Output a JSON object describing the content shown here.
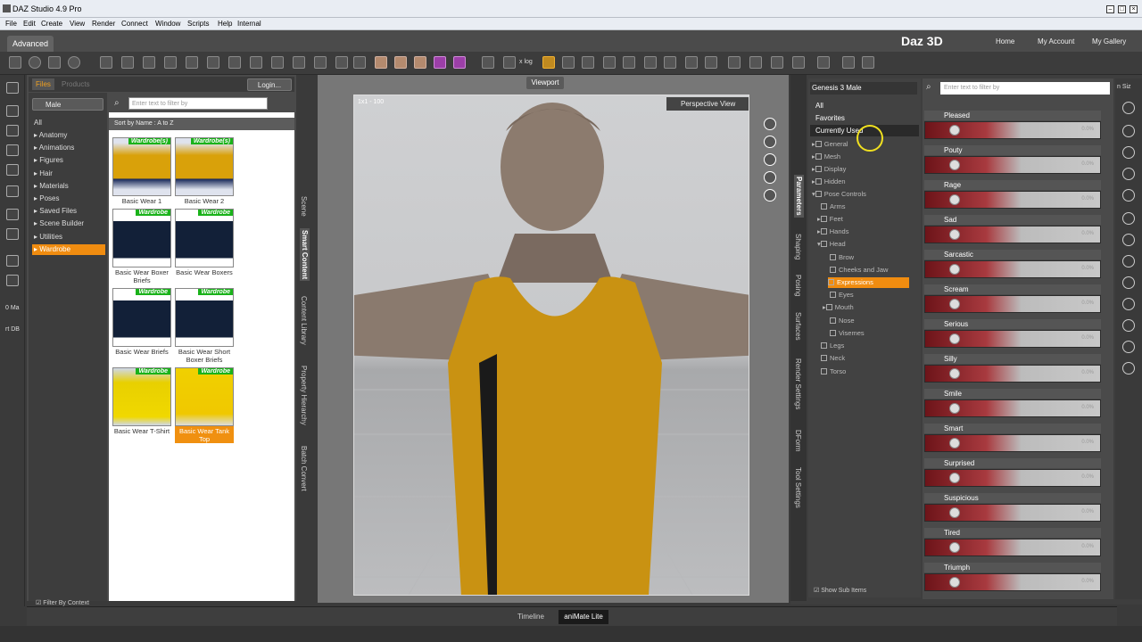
{
  "window": {
    "title": "DAZ Studio 4.9 Pro"
  },
  "menu": [
    "File",
    "Edit",
    "Create",
    "View",
    "Render",
    "Connect",
    "Window",
    "Scripts",
    "Help",
    "Internal"
  ],
  "header": {
    "tab": "Advanced",
    "logo": "Daz 3D",
    "links": [
      "Home",
      "My Account",
      "My Gallery"
    ]
  },
  "toolbar": {
    "xlog": "x log"
  },
  "leftstrip": {
    "label1": "0 Ma",
    "label2": "rt DB"
  },
  "content": {
    "tabs": {
      "files": "Files",
      "products": "Products"
    },
    "login": "Login...",
    "folder_select": "Male",
    "categories": [
      "All",
      "Anatomy",
      "Animations",
      "Figures",
      "Hair",
      "Materials",
      "Poses",
      "Saved Files",
      "Scene Builder",
      "Utilities",
      "Wardrobe"
    ],
    "filter_by_context": "Filter By Context",
    "search_placeholder": "Enter text to filter by",
    "sort": "Sort by Name : A to Z",
    "items": [
      {
        "label": "Basic Wear 1",
        "badge": "Wardrobe(s)"
      },
      {
        "label": "Basic Wear 2",
        "badge": "Wardrobe(s)"
      },
      {
        "label": "Basic Wear Boxer Briefs",
        "badge": "Wardrobe"
      },
      {
        "label": "Basic Wear Boxers",
        "badge": "Wardrobe"
      },
      {
        "label": "Basic Wear Briefs",
        "badge": "Wardrobe"
      },
      {
        "label": "Basic Wear Short Boxer Briefs",
        "badge": "Wardrobe"
      },
      {
        "label": "Basic Wear T-Shirt",
        "badge": "Wardrobe"
      },
      {
        "label": "Basic Wear Tank Top",
        "badge": "Wardrobe"
      }
    ]
  },
  "side_tabs_left": [
    "Scene",
    "Smart Content",
    "Content Library",
    "Property Hierarchy",
    "Batch Convert"
  ],
  "viewport": {
    "label": "Viewport",
    "view": "Perspective View",
    "fps": "1x1 - 100"
  },
  "side_tabs_right": [
    "Parameters",
    "Shaping",
    "Posing",
    "Surfaces",
    "Render Settings",
    "DForm",
    "Tool Settings"
  ],
  "parameters": {
    "figure": "Genesis 3 Male",
    "groups": [
      "All",
      "Favorites",
      "Currently Used"
    ],
    "tree": [
      "General",
      "Mesh",
      "Display",
      "Hidden",
      "Pose Controls",
      "Arms",
      "Feet",
      "Hands",
      "Head",
      "Brow",
      "Cheeks and Jaw",
      "Expressions",
      "Eyes",
      "Mouth",
      "Nose",
      "Visemes",
      "Legs",
      "Neck",
      "Torso"
    ],
    "show_sub_items": "Show Sub Items",
    "search_placeholder": "Enter text to filter by",
    "sliders": [
      "Pleased",
      "Pouty",
      "Rage",
      "Sad",
      "Sarcastic",
      "Scream",
      "Serious",
      "Silly",
      "Smile",
      "Smart",
      "Surprised",
      "Suspicious",
      "Tired",
      "Triumph"
    ],
    "slider_value": "0.0%"
  },
  "right_edge_label": "n Siz",
  "bottom": {
    "timeline": "Timeline",
    "animate": "aniMate Lite"
  }
}
